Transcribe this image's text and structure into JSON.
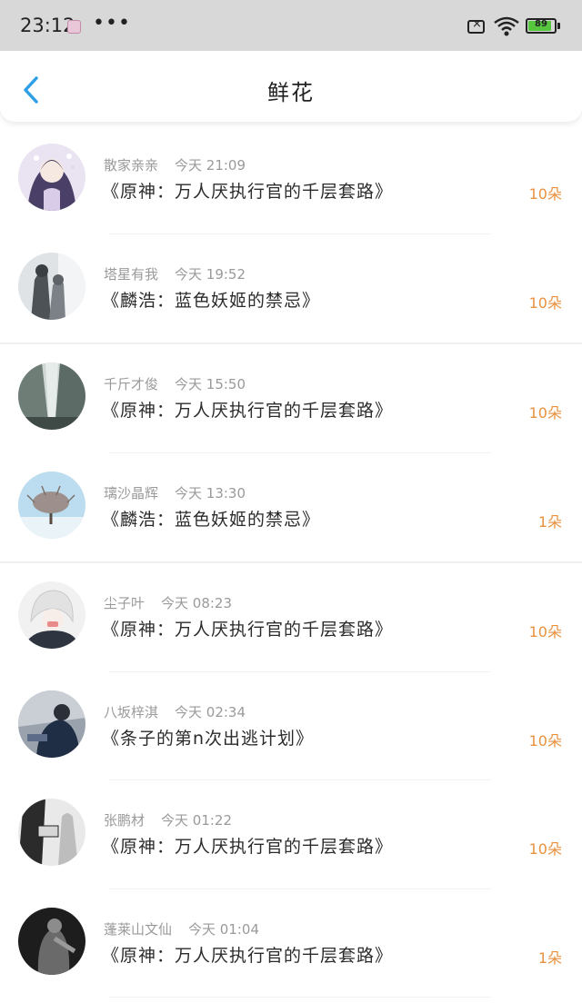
{
  "status_bar": {
    "time": "23:12",
    "dots": "•••",
    "battery": "89",
    "battery_level": 0.89
  },
  "header": {
    "title": "鲜花"
  },
  "colors": {
    "accent_blue": "#2f9fe6",
    "count_orange": "#e8913e",
    "battery_green": "#55c63e"
  },
  "rows": [
    {
      "name": "散家亲亲",
      "time": "今天 21:09",
      "book": "《原神：万人厌执行官的千层套路》",
      "count": "10朵"
    },
    {
      "name": "塔星有我",
      "time": "今天 19:52",
      "book": "《麟浩：蓝色妖姬的禁忌》",
      "count": "10朵"
    },
    {
      "name": "千斤才俊",
      "time": "今天 15:50",
      "book": "《原神：万人厌执行官的千层套路》",
      "count": "10朵"
    },
    {
      "name": "璃沙晶辉",
      "time": "今天 13:30",
      "book": "《麟浩：蓝色妖姬的禁忌》",
      "count": "1朵"
    },
    {
      "name": "尘子叶",
      "time": "今天 08:23",
      "book": "《原神：万人厌执行官的千层套路》",
      "count": "10朵"
    },
    {
      "name": "八坂梓淇",
      "time": "今天 02:34",
      "book": "《条子的第n次出逃计划》",
      "count": "10朵"
    },
    {
      "name": "张鹏材",
      "time": "今天 01:22",
      "book": "《原神：万人厌执行官的千层套路》",
      "count": "10朵"
    },
    {
      "name": "蓬莱山文仙",
      "time": "今天 01:04",
      "book": "《原神：万人厌执行官的千层套路》",
      "count": "1朵"
    }
  ]
}
